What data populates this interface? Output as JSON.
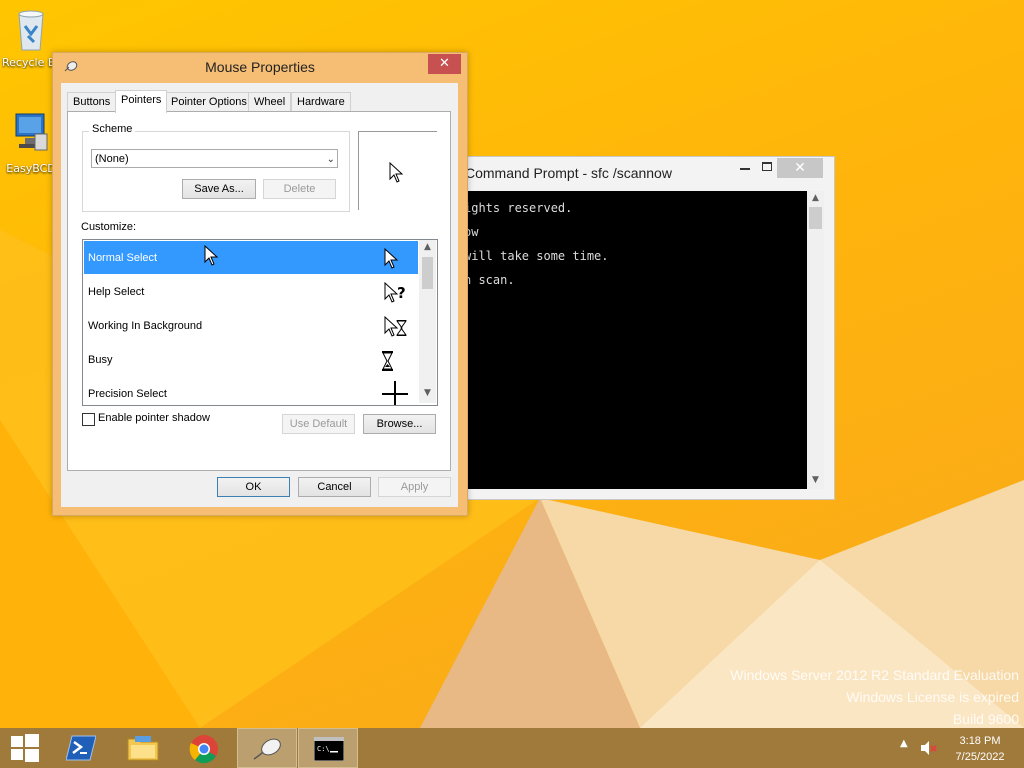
{
  "desktop": {
    "icons": [
      {
        "label": "Recycle Bin",
        "icon": "recycle-bin-icon"
      },
      {
        "label": "EasyBCD",
        "icon": "easybcd-icon"
      }
    ],
    "watermark": [
      "Windows Server 2012 R2 Standard Evaluation",
      "Windows License is expired",
      "Build 9600"
    ],
    "accent": "#ffb90f"
  },
  "cmd": {
    "title": "Command Prompt - sfc  /scannow",
    "lines": [
      "ights reserved.",
      "ow",
      "will take some time.",
      "n scan."
    ]
  },
  "dialog": {
    "title": "Mouse Properties",
    "tabs": [
      "Buttons",
      "Pointers",
      "Pointer Options",
      "Wheel",
      "Hardware"
    ],
    "active_tab": "Pointers",
    "scheme": {
      "legend": "Scheme",
      "value": "(None)",
      "save_as": "Save As...",
      "delete": "Delete"
    },
    "customize_label": "Customize:",
    "pointers": [
      {
        "name": "Normal Select",
        "icon": "arrow-cursor-icon"
      },
      {
        "name": "Help Select",
        "icon": "help-cursor-icon"
      },
      {
        "name": "Working In Background",
        "icon": "working-cursor-icon"
      },
      {
        "name": "Busy",
        "icon": "hourglass-cursor-icon"
      },
      {
        "name": "Precision Select",
        "icon": "crosshair-cursor-icon"
      }
    ],
    "shadow_label": "Enable pointer shadow",
    "use_default": "Use Default",
    "browse": "Browse...",
    "ok": "OK",
    "cancel": "Cancel",
    "apply": "Apply",
    "selection_color": "#3399ff"
  },
  "taskbar": {
    "time": "3:18 PM",
    "date": "7/25/2022",
    "color": "#a07a3a"
  }
}
